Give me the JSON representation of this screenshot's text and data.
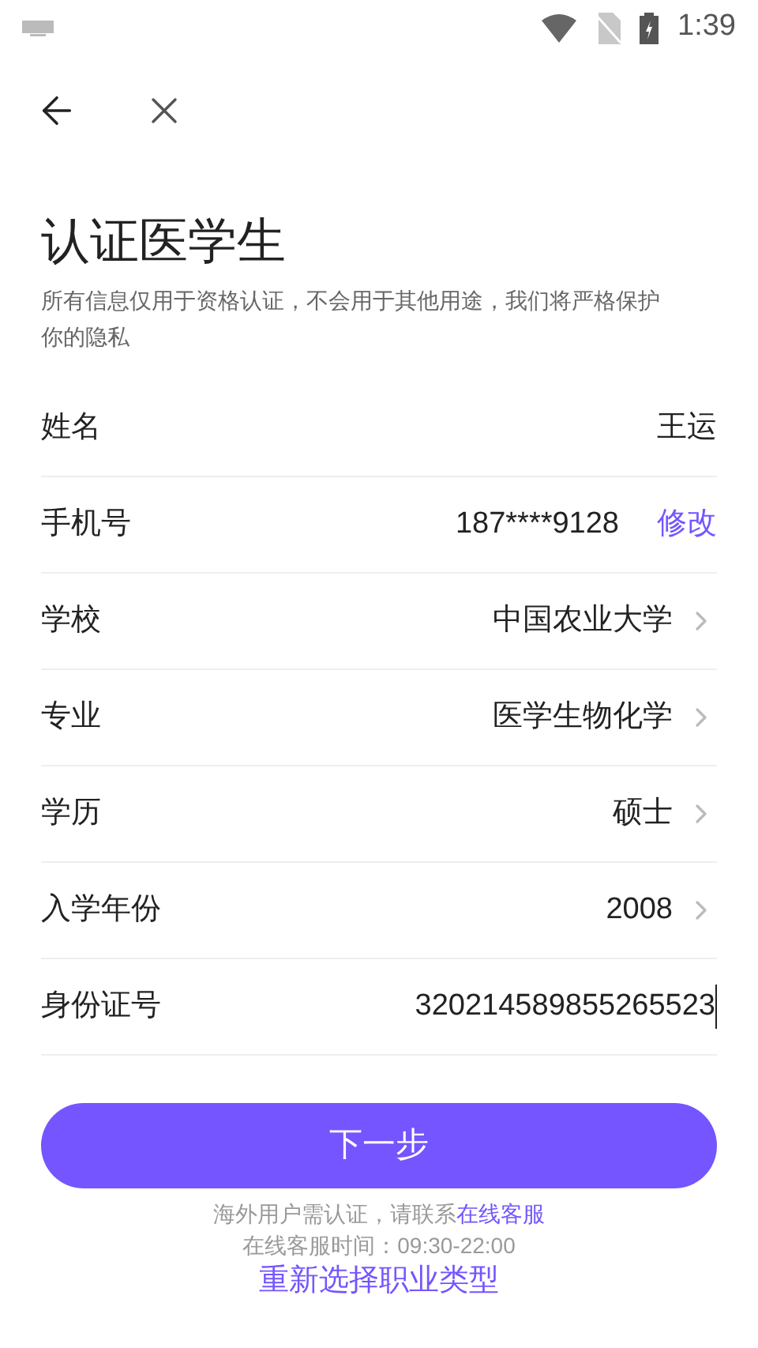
{
  "status_bar": {
    "time": "1:39"
  },
  "title": "认证医学生",
  "subtitle": "所有信息仅用于资格认证，不会用于其他用途，我们将严格保护你的隐私",
  "rows": [
    {
      "kind": "text",
      "label": "姓名",
      "value": "王运"
    },
    {
      "kind": "phone",
      "label": "手机号",
      "value": "187****9128",
      "action": "修改"
    },
    {
      "kind": "select",
      "label": "学校",
      "value": "中国农业大学"
    },
    {
      "kind": "select",
      "label": "专业",
      "value": "医学生物化学"
    },
    {
      "kind": "select",
      "label": "学历",
      "value": "硕士"
    },
    {
      "kind": "select",
      "label": "入学年份",
      "value": "2008"
    },
    {
      "kind": "input",
      "label": "身份证号",
      "value": "320214589855265523"
    }
  ],
  "next_button": "下一步",
  "overseas_note": {
    "text": "海外用户需认证，请联系",
    "link": "在线客服"
  },
  "service_hours": "在线客服时间：09:30-22:00",
  "reselect_link": "重新选择职业类型"
}
